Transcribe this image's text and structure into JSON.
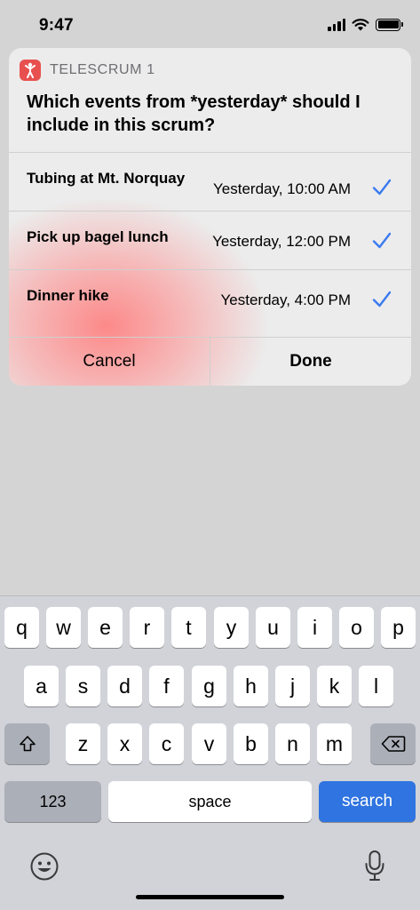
{
  "status_bar": {
    "time": "9:47"
  },
  "card": {
    "app_name": "TELESCRUM 1",
    "question_pre": "Which events from ",
    "question_emph": "*yesterday*",
    "question_post": " should I include in this scrum?",
    "events": [
      {
        "title": "Tubing at Mt. Norquay",
        "time": "Yesterday, 10:00 AM",
        "checked": true
      },
      {
        "title": "Pick up bagel lunch",
        "time": "Yesterday, 12:00 PM",
        "checked": true
      },
      {
        "title": "Dinner hike",
        "time": "Yesterday, 4:00 PM",
        "checked": true
      }
    ],
    "cancel_label": "Cancel",
    "done_label": "Done"
  },
  "keyboard": {
    "row1": [
      "q",
      "w",
      "e",
      "r",
      "t",
      "y",
      "u",
      "i",
      "o",
      "p"
    ],
    "row2": [
      "a",
      "s",
      "d",
      "f",
      "g",
      "h",
      "j",
      "k",
      "l"
    ],
    "row3": [
      "z",
      "x",
      "c",
      "v",
      "b",
      "n",
      "m"
    ],
    "numbers_label": "123",
    "space_label": "space",
    "search_label": "search"
  },
  "colors": {
    "accent": "#2f74e0",
    "check": "#3a7bf0",
    "app_icon": "#e8504f"
  }
}
